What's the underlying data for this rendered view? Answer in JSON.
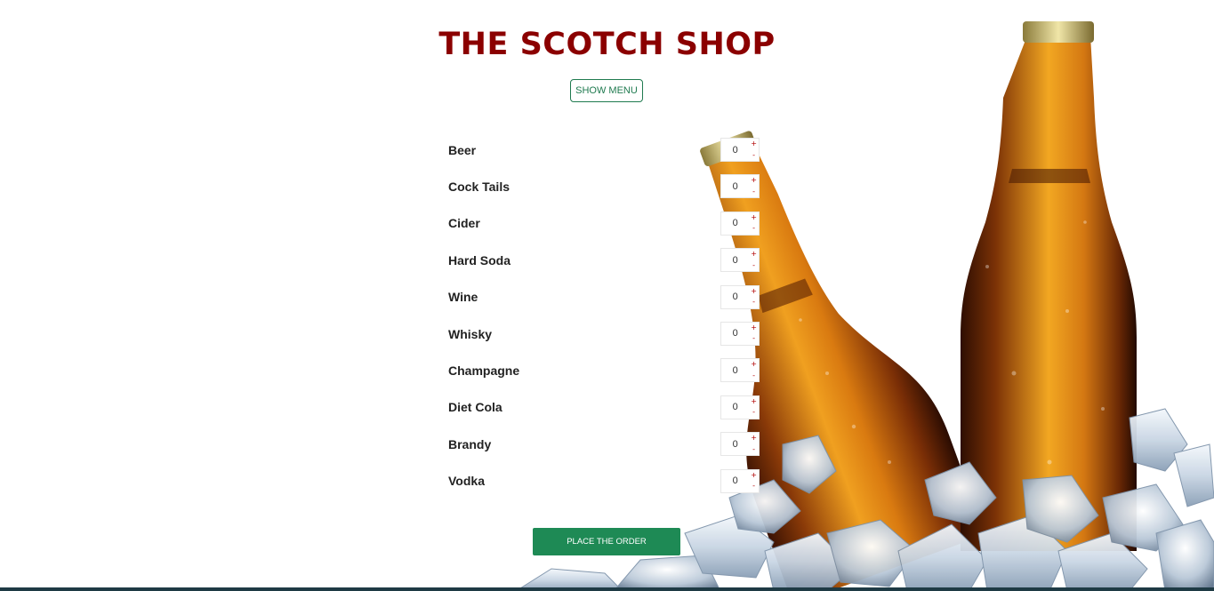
{
  "header": {
    "title": "THE SCOTCH SHOP",
    "show_menu_label": "SHOW MENU"
  },
  "menu": {
    "items": [
      {
        "name": "Beer",
        "quantity": "0"
      },
      {
        "name": "Cock Tails",
        "quantity": "0"
      },
      {
        "name": "Cider",
        "quantity": "0"
      },
      {
        "name": "Hard Soda",
        "quantity": "0"
      },
      {
        "name": "Wine",
        "quantity": "0"
      },
      {
        "name": "Whisky",
        "quantity": "0"
      },
      {
        "name": "Champagne",
        "quantity": "0"
      },
      {
        "name": "Diet Cola",
        "quantity": "0"
      },
      {
        "name": "Brandy",
        "quantity": "0"
      },
      {
        "name": "Vodka",
        "quantity": "0"
      }
    ],
    "increment_symbol": "+",
    "decrement_symbol": "-"
  },
  "order": {
    "place_order_label": "PLACE THE ORDER"
  },
  "colors": {
    "title": "#8b0000",
    "accent_green": "#1e8a55",
    "outline_green": "#1f7a4f"
  },
  "background": {
    "image": "beer-bottles-on-ice"
  }
}
